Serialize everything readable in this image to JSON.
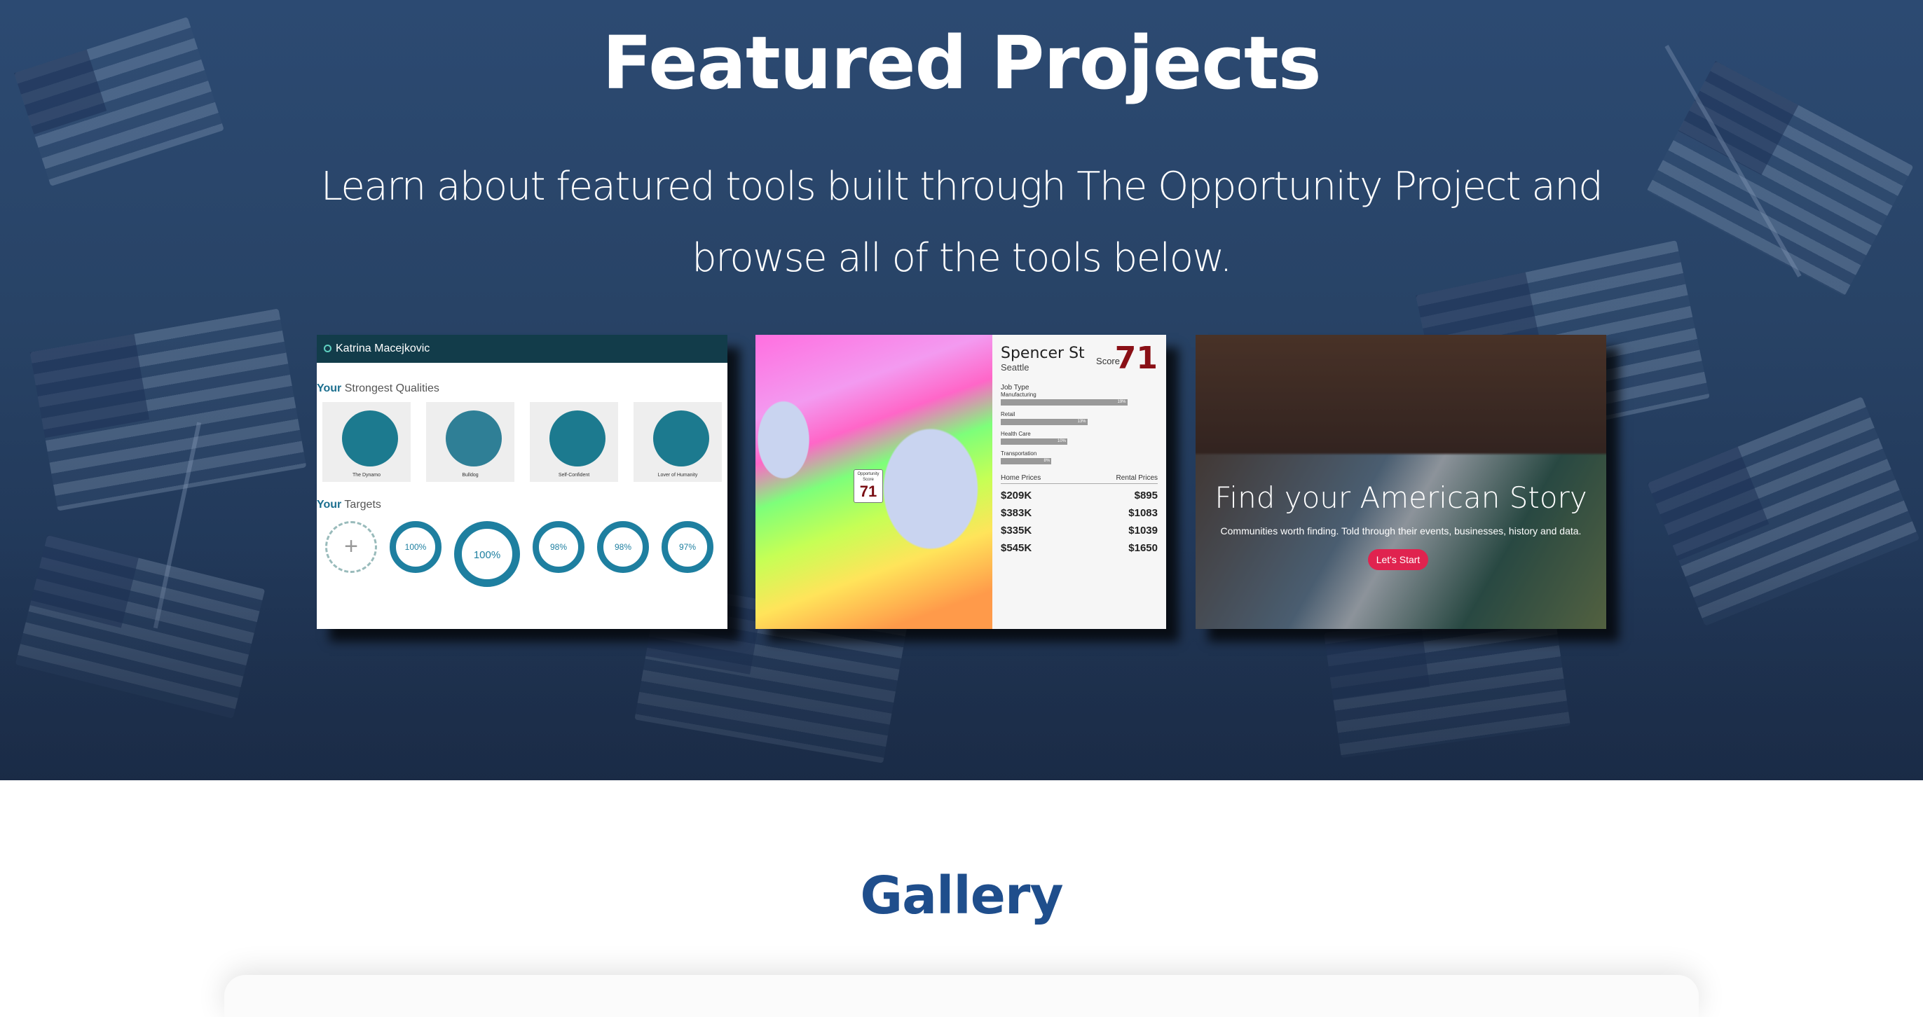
{
  "hero": {
    "title": "Featured Projects",
    "subtitle": "Learn about featured tools built through The Opportunity Project and browse all of the tools below."
  },
  "cards": [
    {
      "header_name": "Katrina Macejkovic",
      "qualities_heading_strong": "Your",
      "qualities_heading": " Strongest Qualities",
      "qualities": [
        "The Dynamo",
        "Bulldog",
        "Self-Confident",
        "Lover of Humanity"
      ],
      "targets_heading_strong": "Your",
      "targets_heading": " Targets",
      "targets": [
        "100%",
        "100%",
        "98%",
        "98%",
        "97%"
      ]
    },
    {
      "street": "Spencer St",
      "city": "Seattle",
      "score_label": "Score",
      "score": "71",
      "pin_label": "Opportunity Score",
      "pin_value": "71",
      "job_type_label": "Job Type",
      "jobs": [
        {
          "label": "Manufacturing",
          "pct": "19%",
          "fill": 0.95
        },
        {
          "label": "Retail",
          "pct": "13%",
          "fill": 0.65
        },
        {
          "label": "Health Care",
          "pct": "10%",
          "fill": 0.5
        },
        {
          "label": "Transportation",
          "pct": "8%",
          "fill": 0.38
        }
      ],
      "home_prices_label": "Home Prices",
      "rental_prices_label": "Rental Prices",
      "prices": [
        {
          "home": "$209K",
          "rent": "$895"
        },
        {
          "home": "$383K",
          "rent": "$1083"
        },
        {
          "home": "$335K",
          "rent": "$1039"
        },
        {
          "home": "$545K",
          "rent": "$1650"
        }
      ]
    },
    {
      "title": "Find your American Story",
      "subtitle": "Communities worth finding. Told through their events, businesses, history and data.",
      "button": "Let's Start"
    }
  ],
  "gallery": {
    "title": "Gallery"
  }
}
